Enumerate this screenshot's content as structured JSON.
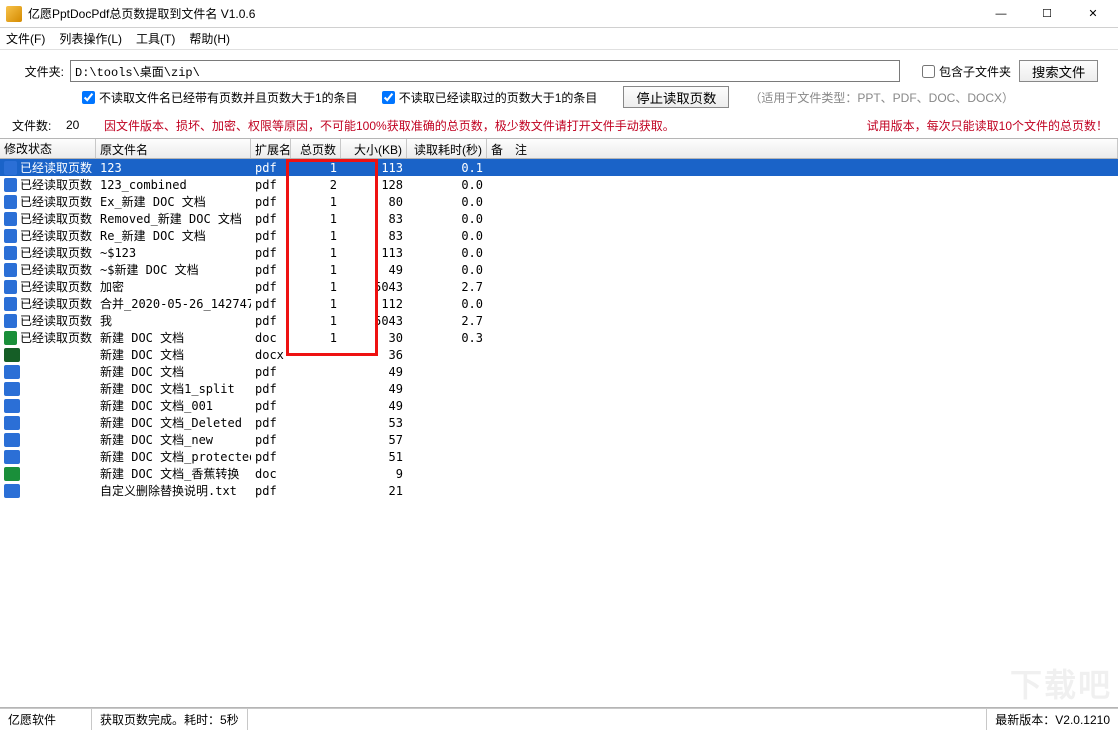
{
  "title": "亿愿PptDocPdf总页数提取到文件名 V1.0.6",
  "menu": {
    "file": "文件(F)",
    "list": "列表操作(L)",
    "tool": "工具(T)",
    "help": "帮助(H)"
  },
  "folder": {
    "label": "文件夹:",
    "path": "D:\\tools\\桌面\\zip\\"
  },
  "opts": {
    "skip_has_pages": "不读取文件名已经带有页数并且页数大于1的条目",
    "skip_read": "不读取已经读取过的页数大于1的条目",
    "sub": "包含子文件夹"
  },
  "buttons": {
    "search": "搜索文件",
    "stop": "停止读取页数"
  },
  "hints": {
    "types": "（适用于文件类型：PPT、PDF、DOC、DOCX）",
    "count_label": "文件数:",
    "count_value": "20",
    "warn1": "因文件版本、损坏、加密、权限等原因，不可能100%获取准确的总页数，极少数文件请打开文件手动获取。",
    "warn2": "试用版本，每次只能读取10个文件的总页数！"
  },
  "columns": {
    "stat": "修改状态",
    "name": "原文件名",
    "ext": "扩展名",
    "pages": "总页数",
    "size": "大小(KB)",
    "time": "读取耗时(秒)",
    "note": "备　注"
  },
  "rows": [
    {
      "stat": "已经读取页数",
      "name": "123",
      "ext": "pdf",
      "pages": "1",
      "size": "113",
      "time": "0.1",
      "sel": true
    },
    {
      "stat": "已经读取页数",
      "name": "123_combined",
      "ext": "pdf",
      "pages": "2",
      "size": "128",
      "time": "0.0"
    },
    {
      "stat": "已经读取页数",
      "name": "Ex_新建 DOC 文档",
      "ext": "pdf",
      "pages": "1",
      "size": "80",
      "time": "0.0"
    },
    {
      "stat": "已经读取页数",
      "name": "Removed_新建 DOC 文档",
      "ext": "pdf",
      "pages": "1",
      "size": "83",
      "time": "0.0"
    },
    {
      "stat": "已经读取页数",
      "name": "Re_新建 DOC 文档",
      "ext": "pdf",
      "pages": "1",
      "size": "83",
      "time": "0.0"
    },
    {
      "stat": "已经读取页数",
      "name": "~$123",
      "ext": "pdf",
      "pages": "1",
      "size": "113",
      "time": "0.0"
    },
    {
      "stat": "已经读取页数",
      "name": "~$新建 DOC 文档",
      "ext": "pdf",
      "pages": "1",
      "size": "49",
      "time": "0.0"
    },
    {
      "stat": "已经读取页数",
      "name": "加密",
      "ext": "pdf",
      "pages": "1",
      "size": "5043",
      "time": "2.7"
    },
    {
      "stat": "已经读取页数",
      "name": "合并_2020-05-26_142747",
      "ext": "pdf",
      "pages": "1",
      "size": "112",
      "time": "0.0"
    },
    {
      "stat": "已经读取页数",
      "name": "我",
      "ext": "pdf",
      "pages": "1",
      "size": "5043",
      "time": "2.7"
    },
    {
      "stat": "已经读取页数",
      "name": "新建 DOC 文档",
      "ext": "doc",
      "pages": "1",
      "size": "30",
      "time": "0.3"
    },
    {
      "stat": "",
      "name": "新建 DOC 文档",
      "ext": "docx",
      "pages": "",
      "size": "36",
      "time": ""
    },
    {
      "stat": "",
      "name": "新建 DOC 文档",
      "ext": "pdf",
      "pages": "",
      "size": "49",
      "time": ""
    },
    {
      "stat": "",
      "name": "新建 DOC 文档1_split",
      "ext": "pdf",
      "pages": "",
      "size": "49",
      "time": ""
    },
    {
      "stat": "",
      "name": "新建 DOC 文档_001",
      "ext": "pdf",
      "pages": "",
      "size": "49",
      "time": ""
    },
    {
      "stat": "",
      "name": "新建 DOC 文档_Deleted",
      "ext": "pdf",
      "pages": "",
      "size": "53",
      "time": ""
    },
    {
      "stat": "",
      "name": "新建 DOC 文档_new",
      "ext": "pdf",
      "pages": "",
      "size": "57",
      "time": ""
    },
    {
      "stat": "",
      "name": "新建 DOC 文档_protected",
      "ext": "pdf",
      "pages": "",
      "size": "51",
      "time": ""
    },
    {
      "stat": "",
      "name": "新建 DOC 文档_香蕉转换",
      "ext": "doc",
      "pages": "",
      "size": "9",
      "time": ""
    },
    {
      "stat": "",
      "name": "自定义删除替换说明.txt",
      "ext": "pdf",
      "pages": "",
      "size": "21",
      "time": ""
    }
  ],
  "status": {
    "vendor": "亿愿软件",
    "msg": "获取页数完成。耗时：5秒",
    "ver": "最新版本：V2.0.1210"
  },
  "watermark": "下载吧"
}
